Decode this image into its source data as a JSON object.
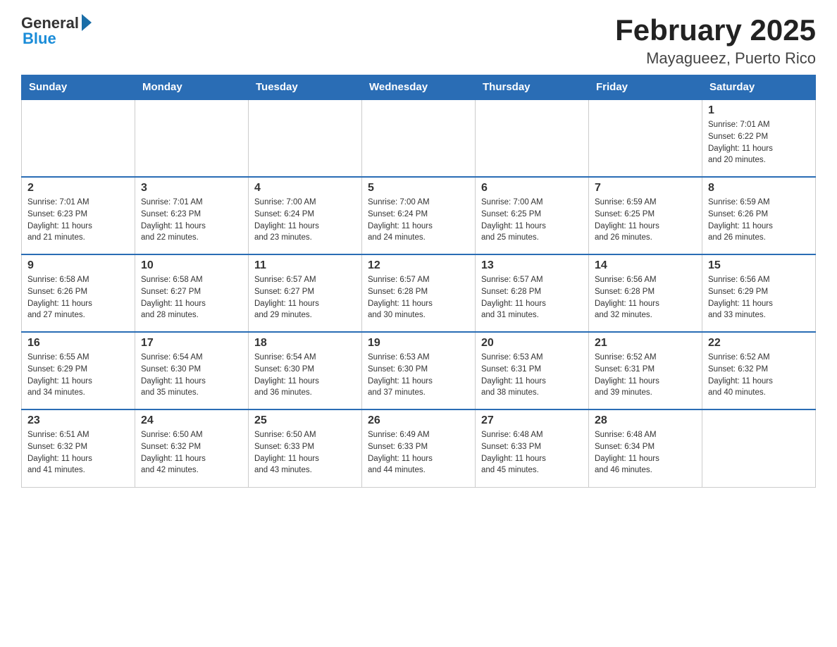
{
  "header": {
    "logo_general": "General",
    "logo_blue": "Blue",
    "title": "February 2025",
    "subtitle": "Mayagueez, Puerto Rico"
  },
  "days_of_week": [
    "Sunday",
    "Monday",
    "Tuesday",
    "Wednesday",
    "Thursday",
    "Friday",
    "Saturday"
  ],
  "weeks": [
    [
      {
        "day": "",
        "info": ""
      },
      {
        "day": "",
        "info": ""
      },
      {
        "day": "",
        "info": ""
      },
      {
        "day": "",
        "info": ""
      },
      {
        "day": "",
        "info": ""
      },
      {
        "day": "",
        "info": ""
      },
      {
        "day": "1",
        "info": "Sunrise: 7:01 AM\nSunset: 6:22 PM\nDaylight: 11 hours\nand 20 minutes."
      }
    ],
    [
      {
        "day": "2",
        "info": "Sunrise: 7:01 AM\nSunset: 6:23 PM\nDaylight: 11 hours\nand 21 minutes."
      },
      {
        "day": "3",
        "info": "Sunrise: 7:01 AM\nSunset: 6:23 PM\nDaylight: 11 hours\nand 22 minutes."
      },
      {
        "day": "4",
        "info": "Sunrise: 7:00 AM\nSunset: 6:24 PM\nDaylight: 11 hours\nand 23 minutes."
      },
      {
        "day": "5",
        "info": "Sunrise: 7:00 AM\nSunset: 6:24 PM\nDaylight: 11 hours\nand 24 minutes."
      },
      {
        "day": "6",
        "info": "Sunrise: 7:00 AM\nSunset: 6:25 PM\nDaylight: 11 hours\nand 25 minutes."
      },
      {
        "day": "7",
        "info": "Sunrise: 6:59 AM\nSunset: 6:25 PM\nDaylight: 11 hours\nand 26 minutes."
      },
      {
        "day": "8",
        "info": "Sunrise: 6:59 AM\nSunset: 6:26 PM\nDaylight: 11 hours\nand 26 minutes."
      }
    ],
    [
      {
        "day": "9",
        "info": "Sunrise: 6:58 AM\nSunset: 6:26 PM\nDaylight: 11 hours\nand 27 minutes."
      },
      {
        "day": "10",
        "info": "Sunrise: 6:58 AM\nSunset: 6:27 PM\nDaylight: 11 hours\nand 28 minutes."
      },
      {
        "day": "11",
        "info": "Sunrise: 6:57 AM\nSunset: 6:27 PM\nDaylight: 11 hours\nand 29 minutes."
      },
      {
        "day": "12",
        "info": "Sunrise: 6:57 AM\nSunset: 6:28 PM\nDaylight: 11 hours\nand 30 minutes."
      },
      {
        "day": "13",
        "info": "Sunrise: 6:57 AM\nSunset: 6:28 PM\nDaylight: 11 hours\nand 31 minutes."
      },
      {
        "day": "14",
        "info": "Sunrise: 6:56 AM\nSunset: 6:28 PM\nDaylight: 11 hours\nand 32 minutes."
      },
      {
        "day": "15",
        "info": "Sunrise: 6:56 AM\nSunset: 6:29 PM\nDaylight: 11 hours\nand 33 minutes."
      }
    ],
    [
      {
        "day": "16",
        "info": "Sunrise: 6:55 AM\nSunset: 6:29 PM\nDaylight: 11 hours\nand 34 minutes."
      },
      {
        "day": "17",
        "info": "Sunrise: 6:54 AM\nSunset: 6:30 PM\nDaylight: 11 hours\nand 35 minutes."
      },
      {
        "day": "18",
        "info": "Sunrise: 6:54 AM\nSunset: 6:30 PM\nDaylight: 11 hours\nand 36 minutes."
      },
      {
        "day": "19",
        "info": "Sunrise: 6:53 AM\nSunset: 6:30 PM\nDaylight: 11 hours\nand 37 minutes."
      },
      {
        "day": "20",
        "info": "Sunrise: 6:53 AM\nSunset: 6:31 PM\nDaylight: 11 hours\nand 38 minutes."
      },
      {
        "day": "21",
        "info": "Sunrise: 6:52 AM\nSunset: 6:31 PM\nDaylight: 11 hours\nand 39 minutes."
      },
      {
        "day": "22",
        "info": "Sunrise: 6:52 AM\nSunset: 6:32 PM\nDaylight: 11 hours\nand 40 minutes."
      }
    ],
    [
      {
        "day": "23",
        "info": "Sunrise: 6:51 AM\nSunset: 6:32 PM\nDaylight: 11 hours\nand 41 minutes."
      },
      {
        "day": "24",
        "info": "Sunrise: 6:50 AM\nSunset: 6:32 PM\nDaylight: 11 hours\nand 42 minutes."
      },
      {
        "day": "25",
        "info": "Sunrise: 6:50 AM\nSunset: 6:33 PM\nDaylight: 11 hours\nand 43 minutes."
      },
      {
        "day": "26",
        "info": "Sunrise: 6:49 AM\nSunset: 6:33 PM\nDaylight: 11 hours\nand 44 minutes."
      },
      {
        "day": "27",
        "info": "Sunrise: 6:48 AM\nSunset: 6:33 PM\nDaylight: 11 hours\nand 45 minutes."
      },
      {
        "day": "28",
        "info": "Sunrise: 6:48 AM\nSunset: 6:34 PM\nDaylight: 11 hours\nand 46 minutes."
      },
      {
        "day": "",
        "info": ""
      }
    ]
  ]
}
